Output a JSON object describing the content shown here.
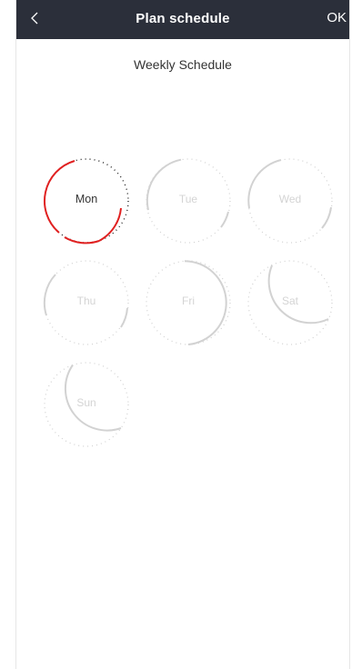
{
  "header": {
    "back_icon": "chevron-left-icon",
    "title": "Plan schedule",
    "ok_label": "OK"
  },
  "page": {
    "heading": "Weekly Schedule"
  },
  "colors": {
    "header_bg": "#2b2f3a",
    "active_arc": "#e02020",
    "inactive_arc": "#cfcfcf",
    "active_text": "#333333",
    "inactive_text": "#d4d4d4"
  },
  "days": [
    {
      "label": "Mon",
      "selected": true
    },
    {
      "label": "Tue",
      "selected": false
    },
    {
      "label": "Wed",
      "selected": false
    },
    {
      "label": "Thu",
      "selected": false
    },
    {
      "label": "Fri",
      "selected": false
    },
    {
      "label": "Sat",
      "selected": false
    },
    {
      "label": "Sun",
      "selected": false
    }
  ]
}
